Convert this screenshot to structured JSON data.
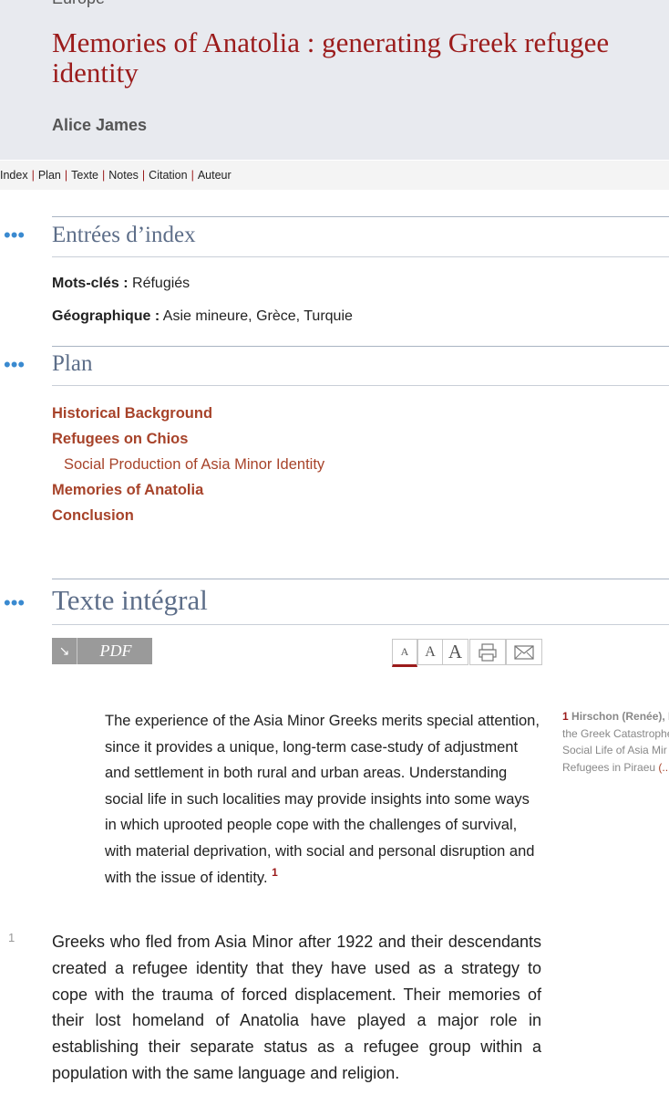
{
  "header": {
    "crumb": "Europe",
    "title": "Memories of Anatolia : generating Greek refugee identity",
    "author": "Alice James"
  },
  "toc_links": [
    "Index",
    "Plan",
    "Texte",
    "Notes",
    "Citation",
    "Auteur"
  ],
  "index": {
    "heading": "Entrées d’index",
    "keywords_label": "Mots-clés :",
    "keywords_value": "Réfugiés",
    "geo_label": "Géographique :",
    "geo_value": "Asie mineure, Grèce, Turquie"
  },
  "plan": {
    "heading": "Plan",
    "items": [
      {
        "label": "Historical Background"
      },
      {
        "label": "Refugees on Chios"
      },
      {
        "label": "Social Production of Asia Minor Identity"
      },
      {
        "label": "Memories of Anatolia"
      },
      {
        "label": "Conclusion"
      }
    ]
  },
  "fulltext": {
    "heading": "Texte intégral",
    "pdf_label": "PDF",
    "pdf_arrow": "↘",
    "tools": [
      "A",
      "A",
      "A"
    ],
    "epigraph": "The experience of the Asia Minor Greeks merits special attention, since it provides a unique, long-term case-study of adjustment and settlement in both rural and urban areas. Understanding social life in such localities may provide insights into some ways in which uprooted people cope with the challenges of survival, with material deprivation, with social and personal disruption and with the issue of identity.",
    "epigraph_note_ref": "1",
    "note_num": "1",
    "note_lines": [
      "Hirschon (Renée), H",
      "the Greek Catastrophe",
      "Social Life of Asia Mir",
      "Refugees in Piraeu"
    ],
    "note_more": "(...",
    "para_num": "1",
    "para_text": "Greeks who fled from Asia Minor after 1922 and their descendants created a refugee identity that they have used as a strategy to cope with the trauma of forced displacement. Their memories of their lost homeland of Anatolia have played a major role in establishing their separate status as a refugee group within a population with the same language and religion."
  }
}
